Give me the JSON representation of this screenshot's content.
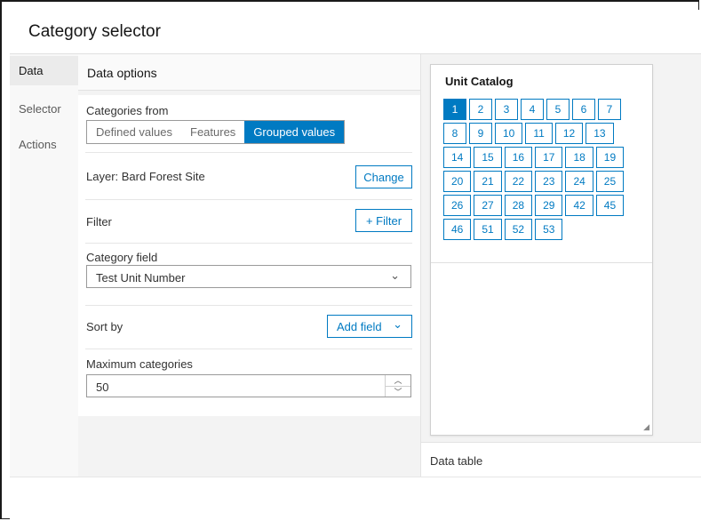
{
  "window": {
    "title": "Category selector"
  },
  "tabs": [
    {
      "label": "Data",
      "active": true
    },
    {
      "label": "Selector",
      "active": false
    },
    {
      "label": "Actions",
      "active": false
    }
  ],
  "panel": {
    "header": "Data options",
    "categories_from": {
      "label": "Categories from",
      "options": [
        "Defined values",
        "Features",
        "Grouped values"
      ],
      "selected": "Grouped values"
    },
    "layer": {
      "label": "Layer: Bard Forest Site",
      "button": "Change"
    },
    "filter": {
      "label": "Filter",
      "button": "+ Filter"
    },
    "category_field": {
      "label": "Category field",
      "value": "Test Unit Number"
    },
    "sort_by": {
      "label": "Sort by",
      "button": "Add field"
    },
    "max_categories": {
      "label": "Maximum categories",
      "value": "50"
    }
  },
  "preview": {
    "title": "Unit Catalog",
    "rows": [
      [
        "1",
        "2",
        "3",
        "4",
        "5",
        "6",
        "7"
      ],
      [
        "8",
        "9",
        "10",
        "11",
        "12",
        "13"
      ],
      [
        "14",
        "15",
        "16",
        "17",
        "18",
        "19"
      ],
      [
        "20",
        "21",
        "22",
        "23",
        "24",
        "25"
      ],
      [
        "26",
        "27",
        "28",
        "29",
        "42",
        "45"
      ],
      [
        "46",
        "51",
        "52",
        "53"
      ]
    ],
    "selected": "1"
  },
  "data_table": {
    "label": "Data table"
  },
  "colors": {
    "accent": "#007ac2",
    "border": "#9a9a9a",
    "panel_bg": "#f3f3f3"
  },
  "icons": {
    "chevron": "chevron-down-icon",
    "spin_up": "chevron-up-icon",
    "spin_down": "chevron-down-icon",
    "resize": "resize-grip-icon"
  }
}
